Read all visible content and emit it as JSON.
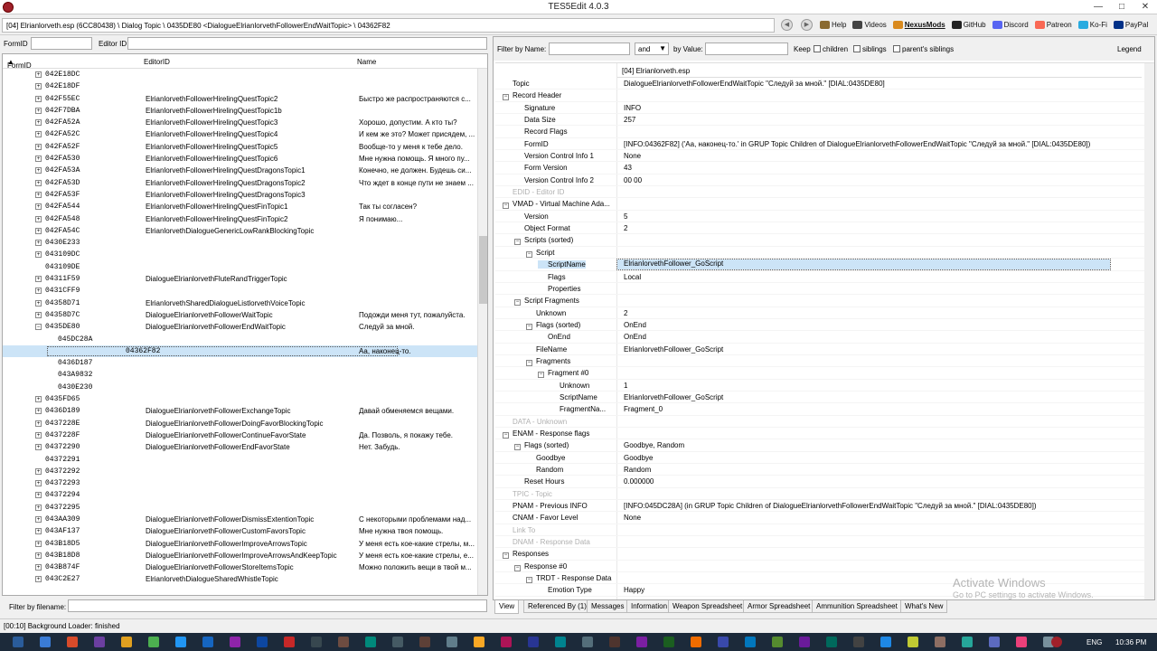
{
  "window": {
    "title": "TES5Edit 4.0.3"
  },
  "path": "[04] Elrianlorveth.esp (6CC80438) \\ Dialog Topic \\ 0435DE80 <DialogueElrianlorvethFollowerEndWaitTopic> \\ 04362F82",
  "toplinks": [
    {
      "label": "Help",
      "icon": "book-icon",
      "color": "#8a6a30"
    },
    {
      "label": "Videos",
      "icon": "video-icon",
      "color": "#444"
    },
    {
      "label": "NexusMods",
      "icon": "nexus-icon",
      "color": "#d98a1e",
      "bold": true
    },
    {
      "label": "GitHub",
      "icon": "github-icon",
      "color": "#222"
    },
    {
      "label": "Discord",
      "icon": "discord-icon",
      "color": "#5865f2"
    },
    {
      "label": "Patreon",
      "icon": "patreon-icon",
      "color": "#f96854"
    },
    {
      "label": "Ko-Fi",
      "icon": "kofi-icon",
      "color": "#29abe0"
    },
    {
      "label": "PayPal",
      "icon": "paypal-icon",
      "color": "#003087"
    }
  ],
  "left": {
    "formid_label": "FormID",
    "editorid_label": "Editor ID",
    "columns": {
      "formid": "FormID",
      "editorid": "EditorID",
      "name": "Name"
    },
    "rows": [
      {
        "id": "042E18DC",
        "ed": "",
        "nm": "",
        "lvl": 0,
        "exp": true
      },
      {
        "id": "042E18DF",
        "ed": "",
        "nm": "",
        "lvl": 0,
        "exp": true
      },
      {
        "id": "042F55EC",
        "ed": "ElrianlorvethFollowerHirelingQuestTopic2",
        "nm": "Быстро же распространяются с...",
        "lvl": 0,
        "exp": true
      },
      {
        "id": "042F7DBA",
        "ed": "ElrianlorvethFollowerHirelingQuestTopic1b",
        "nm": "",
        "lvl": 0,
        "exp": true
      },
      {
        "id": "042FA52A",
        "ed": "ElrianlorvethFollowerHirelingQuestTopic3",
        "nm": "Хорошо, допустим. А кто ты?",
        "lvl": 0,
        "exp": true
      },
      {
        "id": "042FA52C",
        "ed": "ElrianlorvethFollowerHirelingQuestTopic4",
        "nm": "И кем же это? Может присядем, ...",
        "lvl": 0,
        "exp": true
      },
      {
        "id": "042FA52F",
        "ed": "ElrianlorvethFollowerHirelingQuestTopic5",
        "nm": "Вообще-то у меня к тебе дело.",
        "lvl": 0,
        "exp": true
      },
      {
        "id": "042FA530",
        "ed": "ElrianlorvethFollowerHirelingQuestTopic6",
        "nm": "Мне нужна помощь. Я много пу...",
        "lvl": 0,
        "exp": true
      },
      {
        "id": "042FA53A",
        "ed": "ElrianlorvethFollowerHirelingQuestDragonsTopic1",
        "nm": "Конечно, не должен. Будешь си...",
        "lvl": 0,
        "exp": true
      },
      {
        "id": "042FA53D",
        "ed": "ElrianlorvethFollowerHirelingQuestDragonsTopic2",
        "nm": "Что ждет в конце пути не знаем ...",
        "lvl": 0,
        "exp": true
      },
      {
        "id": "042FA53F",
        "ed": "ElrianlorvethFollowerHirelingQuestDragonsTopic3",
        "nm": "",
        "lvl": 0,
        "exp": true
      },
      {
        "id": "042FA544",
        "ed": "ElrianlorvethFollowerHirelingQuestFinTopic1",
        "nm": "Так ты согласен?",
        "lvl": 0,
        "exp": true
      },
      {
        "id": "042FA548",
        "ed": "ElrianlorvethFollowerHirelingQuestFinTopic2",
        "nm": "Я понимаю...",
        "lvl": 0,
        "exp": true
      },
      {
        "id": "042FA54C",
        "ed": "ElrianlorvethDialogueGenericLowRankBlockingTopic",
        "nm": "",
        "lvl": 0,
        "exp": true
      },
      {
        "id": "0430E233",
        "ed": "",
        "nm": "",
        "lvl": 0,
        "exp": true
      },
      {
        "id": "043109DC",
        "ed": "",
        "nm": "",
        "lvl": 0,
        "exp": true
      },
      {
        "id": "043109DE",
        "ed": "",
        "nm": "",
        "lvl": 0,
        "exp": false
      },
      {
        "id": "04311F59",
        "ed": "DialogueElrianlorvethFluteRandTriggerTopic",
        "nm": "",
        "lvl": 0,
        "exp": true
      },
      {
        "id": "0431CFF9",
        "ed": "",
        "nm": "",
        "lvl": 0,
        "exp": true
      },
      {
        "id": "04358D71",
        "ed": "ElrianlorvethSharedDialogueListlorvethVoiceTopic",
        "nm": "",
        "lvl": 0,
        "exp": true
      },
      {
        "id": "04358D7C",
        "ed": "DialogueElrianlorvethFollowerWaitTopic",
        "nm": "Подожди меня тут, пожалуйста.",
        "lvl": 0,
        "exp": true
      },
      {
        "id": "0435DE80",
        "ed": "DialogueElrianlorvethFollowerEndWaitTopic",
        "nm": "Следуй за мной.",
        "lvl": 0,
        "exp": true,
        "open": true
      },
      {
        "id": "045DC28A",
        "ed": "",
        "nm": "",
        "lvl": 1,
        "exp": false
      },
      {
        "id": "04362F82",
        "ed": "",
        "nm": "Аа, наконец-то.",
        "lvl": 1,
        "exp": false,
        "sel": true
      },
      {
        "id": "0436D187",
        "ed": "",
        "nm": "",
        "lvl": 1,
        "exp": false
      },
      {
        "id": "043A9832",
        "ed": "",
        "nm": "",
        "lvl": 1,
        "exp": false
      },
      {
        "id": "0430E230",
        "ed": "",
        "nm": "",
        "lvl": 1,
        "exp": false
      },
      {
        "id": "0435FD65",
        "ed": "",
        "nm": "",
        "lvl": 0,
        "exp": true
      },
      {
        "id": "0436D189",
        "ed": "DialogueElrianlorvethFollowerExchangeTopic",
        "nm": "Давай обменяемся вещами.",
        "lvl": 0,
        "exp": true
      },
      {
        "id": "0437228E",
        "ed": "DialogueElrianlorvethFollowerDoingFavorBlockingTopic",
        "nm": "",
        "lvl": 0,
        "exp": true
      },
      {
        "id": "0437228F",
        "ed": "DialogueElrianlorvethFollowerContinueFavorState",
        "nm": "Да. Позволь, я покажу тебе.",
        "lvl": 0,
        "exp": true
      },
      {
        "id": "04372290",
        "ed": "DialogueElrianlorvethFollowerEndFavorState",
        "nm": "Нет. Забудь.",
        "lvl": 0,
        "exp": true
      },
      {
        "id": "04372291",
        "ed": "",
        "nm": "",
        "lvl": 0,
        "exp": false
      },
      {
        "id": "04372292",
        "ed": "",
        "nm": "",
        "lvl": 0,
        "exp": true
      },
      {
        "id": "04372293",
        "ed": "",
        "nm": "",
        "lvl": 0,
        "exp": true
      },
      {
        "id": "04372294",
        "ed": "",
        "nm": "",
        "lvl": 0,
        "exp": true
      },
      {
        "id": "04372295",
        "ed": "",
        "nm": "",
        "lvl": 0,
        "exp": true
      },
      {
        "id": "043AA309",
        "ed": "DialogueElrianlorvethFollowerDismissExtentionTopic",
        "nm": "С некоторыми проблемами над...",
        "lvl": 0,
        "exp": true
      },
      {
        "id": "043AF137",
        "ed": "DialogueElrianlorvethFollowerCustomFavorsTopic",
        "nm": "Мне нужна твоя помощь.",
        "lvl": 0,
        "exp": true
      },
      {
        "id": "043B18D5",
        "ed": "DialogueElrianlorvethFollowerImproveArrowsTopic",
        "nm": "У меня есть кое-какие стрелы, м...",
        "lvl": 0,
        "exp": true
      },
      {
        "id": "043B18D8",
        "ed": "DialogueElrianlorvethFollowerImproveArrowsAndKeepTopic",
        "nm": "У меня есть кое-какие стрелы, е...",
        "lvl": 0,
        "exp": true
      },
      {
        "id": "043B874F",
        "ed": "DialogueElrianlorvethFollowerStoreItemsTopic",
        "nm": "Можно положить вещи в твой м...",
        "lvl": 0,
        "exp": true
      },
      {
        "id": "043C2E27",
        "ed": "ElrianlorvethDialogueSharedWhistleTopic",
        "nm": "",
        "lvl": 0,
        "exp": true
      }
    ],
    "filter_label": "Filter by filename:"
  },
  "right": {
    "filter_name_label": "Filter by Name:",
    "and_value": "and",
    "by_value_label": "by Value:",
    "keep_label": "Keep",
    "children_label": "children",
    "siblings_label": "siblings",
    "parents_siblings_label": "parent's siblings",
    "legend_label": "Legend",
    "header": "[04] Elrianlorveth.esp",
    "rows": [
      {
        "k": "Topic",
        "v": "DialogueElrianlorvethFollowerEndWaitTopic \"Следуй за мной.\" [DIAL:0435DE80]",
        "lvl": 0,
        "exp": false
      },
      {
        "k": "Record Header",
        "v": "",
        "lvl": 0,
        "exp": true
      },
      {
        "k": "Signature",
        "v": "INFO",
        "lvl": 1,
        "exp": false
      },
      {
        "k": "Data Size",
        "v": "257",
        "lvl": 1,
        "exp": false
      },
      {
        "k": "Record Flags",
        "v": "",
        "lvl": 1,
        "exp": false
      },
      {
        "k": "FormID",
        "v": "[INFO:04362F82] ('Аа, наконец-то.' in GRUP Topic Children of DialogueElrianlorvethFollowerEndWaitTopic \"Следуй за мной.\" [DIAL:0435DE80])",
        "lvl": 1,
        "exp": false
      },
      {
        "k": "Version Control Info 1",
        "v": "None",
        "lvl": 1,
        "exp": false
      },
      {
        "k": "Form Version",
        "v": "43",
        "lvl": 1,
        "exp": false
      },
      {
        "k": "Version Control Info 2",
        "v": "00 00",
        "lvl": 1,
        "exp": false
      },
      {
        "k": "EDID - Editor ID",
        "v": "",
        "lvl": 0,
        "exp": false,
        "dis": true
      },
      {
        "k": "VMAD - Virtual Machine Ada...",
        "v": "",
        "lvl": 0,
        "exp": true
      },
      {
        "k": "Version",
        "v": "5",
        "lvl": 1,
        "exp": false
      },
      {
        "k": "Object Format",
        "v": "2",
        "lvl": 1,
        "exp": false
      },
      {
        "k": "Scripts (sorted)",
        "v": "",
        "lvl": 1,
        "exp": true
      },
      {
        "k": "Script",
        "v": "",
        "lvl": 2,
        "exp": true
      },
      {
        "k": "ScriptName",
        "v": "ElrianlorvethFollower_GoScript",
        "lvl": 3,
        "exp": false,
        "sel": true
      },
      {
        "k": "Flags",
        "v": "Local",
        "lvl": 3,
        "exp": false
      },
      {
        "k": "Properties",
        "v": "",
        "lvl": 3,
        "exp": false
      },
      {
        "k": "Script Fragments",
        "v": "",
        "lvl": 1,
        "exp": true
      },
      {
        "k": "Unknown",
        "v": "2",
        "lvl": 2,
        "exp": false
      },
      {
        "k": "Flags (sorted)",
        "v": "OnEnd",
        "lvl": 2,
        "exp": true
      },
      {
        "k": "OnEnd",
        "v": "OnEnd",
        "lvl": 3,
        "exp": false
      },
      {
        "k": "FileName",
        "v": "ElrianlorvethFollower_GoScript",
        "lvl": 2,
        "exp": false
      },
      {
        "k": "Fragments",
        "v": "",
        "lvl": 2,
        "exp": true
      },
      {
        "k": "Fragment #0",
        "v": "",
        "lvl": 3,
        "exp": true
      },
      {
        "k": "Unknown",
        "v": "1",
        "lvl": 4,
        "exp": false
      },
      {
        "k": "ScriptName",
        "v": "ElrianlorvethFollower_GoScript",
        "lvl": 4,
        "exp": false
      },
      {
        "k": "FragmentNa...",
        "v": "Fragment_0",
        "lvl": 4,
        "exp": false
      },
      {
        "k": "DATA - Unknown",
        "v": "",
        "lvl": 0,
        "exp": false,
        "dis": true
      },
      {
        "k": "ENAM - Response flags",
        "v": "",
        "lvl": 0,
        "exp": true
      },
      {
        "k": "Flags (sorted)",
        "v": "Goodbye, Random",
        "lvl": 1,
        "exp": true
      },
      {
        "k": "Goodbye",
        "v": "Goodbye",
        "lvl": 2,
        "exp": false
      },
      {
        "k": "Random",
        "v": "Random",
        "lvl": 2,
        "exp": false
      },
      {
        "k": "Reset Hours",
        "v": "0.000000",
        "lvl": 1,
        "exp": false
      },
      {
        "k": "TPIC - Topic",
        "v": "",
        "lvl": 0,
        "exp": false,
        "dis": true
      },
      {
        "k": "PNAM - Previous INFO",
        "v": "[INFO:045DC28A] (in GRUP Topic Children of DialogueElrianlorvethFollowerEndWaitTopic \"Следуй за мной.\" [DIAL:0435DE80])",
        "lvl": 0,
        "exp": false
      },
      {
        "k": "CNAM - Favor Level",
        "v": "None",
        "lvl": 0,
        "exp": false
      },
      {
        "k": "Link To",
        "v": "",
        "lvl": 0,
        "exp": false,
        "dis": true
      },
      {
        "k": "DNAM - Response Data",
        "v": "",
        "lvl": 0,
        "exp": false,
        "dis": true
      },
      {
        "k": "Responses",
        "v": "",
        "lvl": 0,
        "exp": true
      },
      {
        "k": "Response #0",
        "v": "",
        "lvl": 1,
        "exp": true
      },
      {
        "k": "TRDT - Response Data",
        "v": "",
        "lvl": 2,
        "exp": true
      },
      {
        "k": "Emotion Type",
        "v": "Happy",
        "lvl": 3,
        "exp": false
      }
    ],
    "tabs": [
      "View",
      "Referenced By (1)",
      "Messages",
      "Information",
      "Weapon Spreadsheet",
      "Armor Spreadsheet",
      "Ammunition Spreadsheet",
      "What's New"
    ]
  },
  "status": "[00:10] Background Loader: finished",
  "watermark": {
    "line1": "Activate Windows",
    "line2": "Go to PC settings to activate Windows."
  },
  "tray": {
    "lang": "ENG",
    "time": "10:36 PM"
  }
}
